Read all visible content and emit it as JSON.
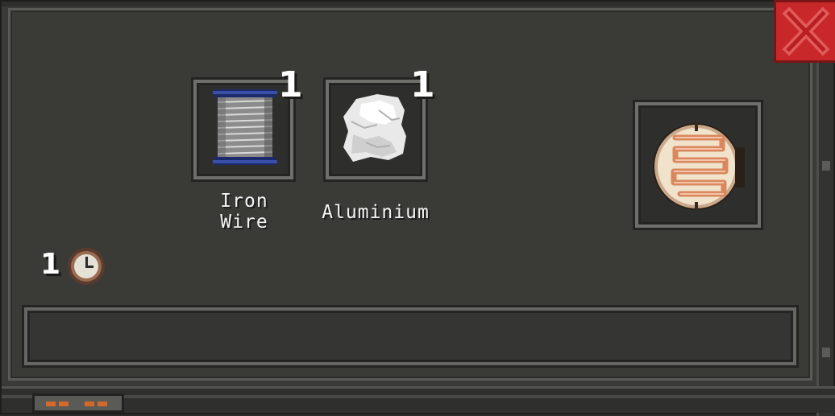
{
  "recipe": {
    "ingredients": [
      {
        "name": "Iron\nWire",
        "count": "1",
        "icon": "wire-spool-icon"
      },
      {
        "name": "Aluminium",
        "count": "1",
        "icon": "aluminium-chunk-icon"
      }
    ],
    "result": {
      "icon": "photoresistor-icon"
    },
    "time": {
      "value": "1",
      "icon": "clock-icon"
    }
  },
  "description": {
    "text": ""
  },
  "close": {
    "icon": "close-x-icon"
  },
  "colors": {
    "close": "#c8282a",
    "panel": "#3a3a37",
    "slot_border": "#6f6f6c"
  }
}
